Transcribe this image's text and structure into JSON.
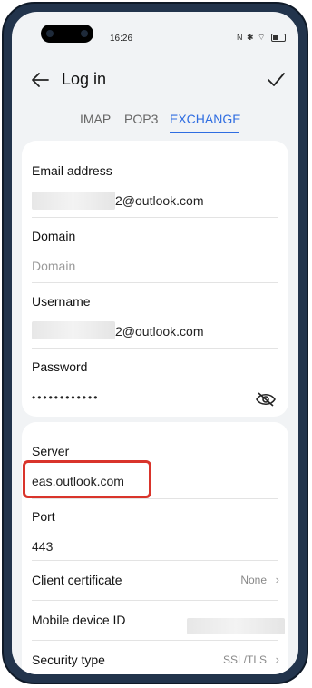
{
  "status": {
    "time": "16:26",
    "icons_text": "N ✱ ⌔"
  },
  "header": {
    "title": "Log in"
  },
  "tabs": [
    "IMAP",
    "POP3",
    "EXCHANGE"
  ],
  "active_tab": "EXCHANGE",
  "account": {
    "email_label": "Email address",
    "email_value_suffix": "2@outlook.com",
    "domain_label": "Domain",
    "domain_placeholder": "Domain",
    "username_label": "Username",
    "username_value_suffix": "2@outlook.com",
    "password_label": "Password",
    "password_mask": "••••••••••••"
  },
  "server": {
    "server_label": "Server",
    "server_value": "eas.outlook.com",
    "port_label": "Port",
    "port_value": "443",
    "client_cert_label": "Client certificate",
    "client_cert_value": "None",
    "mobile_device_label": "Mobile device ID",
    "security_type_label": "Security type",
    "security_type_value": "SSL/TLS"
  },
  "colors": {
    "accent": "#2f6de1",
    "highlight": "#d9342b"
  }
}
